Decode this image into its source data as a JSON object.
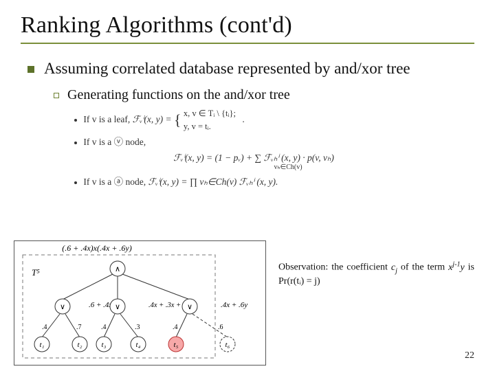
{
  "title": "Ranking Algorithms (cont'd)",
  "bullet_main": "Assuming correlated database represented by and/xor tree",
  "sub_bullet": "Generating functions on the and/xor tree",
  "formulas": {
    "leaf_prefix": "If v is a leaf, ",
    "leaf_func": "ℱᵥⁱ(x, y) = ",
    "leaf_case_a": "x,   v ∈ Tᵢ \\ {tᵢ};",
    "leaf_case_b": "y,   v = tᵢ.",
    "or_prefix": "If v is a ⓥ node,",
    "or_body": "ℱᵥⁱ(x, y) = (1 − pᵥ) +  ∑  ℱᵥₕⁱ (x, y) · p(v, vₕ)",
    "or_sum_under": "vₕ∈Ch(v)",
    "and_prefix": "If v is a ⓐ node, ",
    "and_body": "ℱᵥⁱ(x, y) = ∏ vₕ∈Ch(v) ℱᵥₕⁱ (x, y)."
  },
  "diagram": {
    "root_expr": "(.6 + .4x)x(.4x + .6y)",
    "label_left": "T⁵",
    "or1": ".6 + .4x",
    "or2": ".4x + .3x + .3",
    "or3": ".4x + .6y",
    "leafs": {
      "t1": {
        "name": "t₁",
        "prob": ".4"
      },
      "t2": {
        "name": "t₂",
        "prob": ".7"
      },
      "t3": {
        "name": "t₃",
        "prob": ".4"
      },
      "t4": {
        "name": "t₄",
        "prob": ".3"
      },
      "t5": {
        "name": "t₅",
        "prob": ".4"
      },
      "t6": {
        "name": "t₆",
        "prob": ".6"
      }
    }
  },
  "observation_prefix": "Observation: the coefficient ",
  "observation_mid": " of the term ",
  "observation_suffix": " is Pr(r(tᵢ) = j)",
  "page_number": "22"
}
